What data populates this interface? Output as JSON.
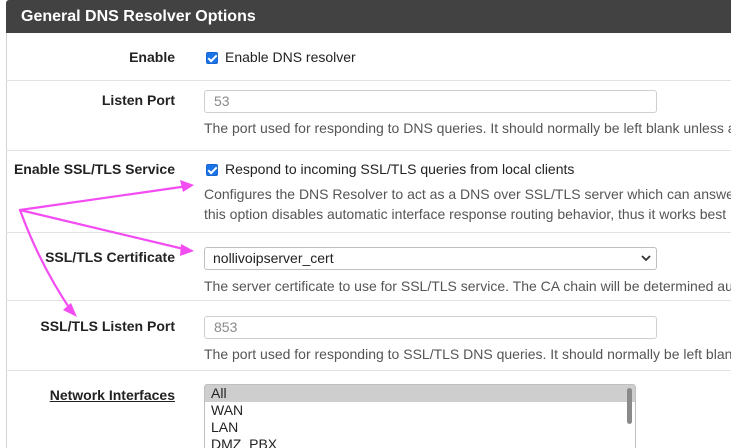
{
  "panel": {
    "title": "General DNS Resolver Options"
  },
  "enable": {
    "label": "Enable",
    "checkbox_label": "Enable DNS resolver",
    "checked": true
  },
  "listen_port": {
    "label": "Listen Port",
    "placeholder": "53",
    "help": "The port used for responding to DNS queries. It should normally be left blank unless a"
  },
  "ssl_service": {
    "label": "Enable SSL/TLS Service",
    "checkbox_label": "Respond to incoming SSL/TLS queries from local clients",
    "checked": true,
    "help_line1": "Configures the DNS Resolver to act as a DNS over SSL/TLS server which can answer",
    "help_line2": "this option disables automatic interface response routing behavior, thus it works best"
  },
  "ssl_cert": {
    "label": "SSL/TLS Certificate",
    "selected": "nollivoipserver_cert",
    "help": "The server certificate to use for SSL/TLS service. The CA chain will be determined au"
  },
  "ssl_listen_port": {
    "label": "SSL/TLS Listen Port",
    "placeholder": "853",
    "help": "The port used for responding to SSL/TLS DNS queries. It should normally be left blan"
  },
  "network_interfaces": {
    "label": "Network Interfaces",
    "options": [
      "All",
      "WAN",
      "LAN",
      "DMZ_PBX"
    ],
    "selected": "All"
  },
  "annotation": {
    "color": "#f24cf2"
  }
}
